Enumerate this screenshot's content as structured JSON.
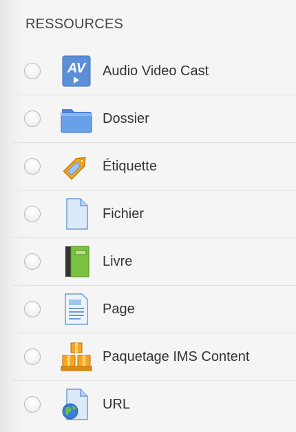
{
  "section": {
    "title": "RESSOURCES"
  },
  "items": [
    {
      "label": "Audio Video Cast",
      "icon": "audio-video-cast-icon"
    },
    {
      "label": "Dossier",
      "icon": "folder-icon"
    },
    {
      "label": "Étiquette",
      "icon": "label-tag-icon"
    },
    {
      "label": "Fichier",
      "icon": "file-icon"
    },
    {
      "label": "Livre",
      "icon": "book-icon"
    },
    {
      "label": "Page",
      "icon": "page-icon"
    },
    {
      "label": "Paquetage IMS Content",
      "icon": "ims-package-icon"
    },
    {
      "label": "URL",
      "icon": "url-globe-icon"
    }
  ]
}
